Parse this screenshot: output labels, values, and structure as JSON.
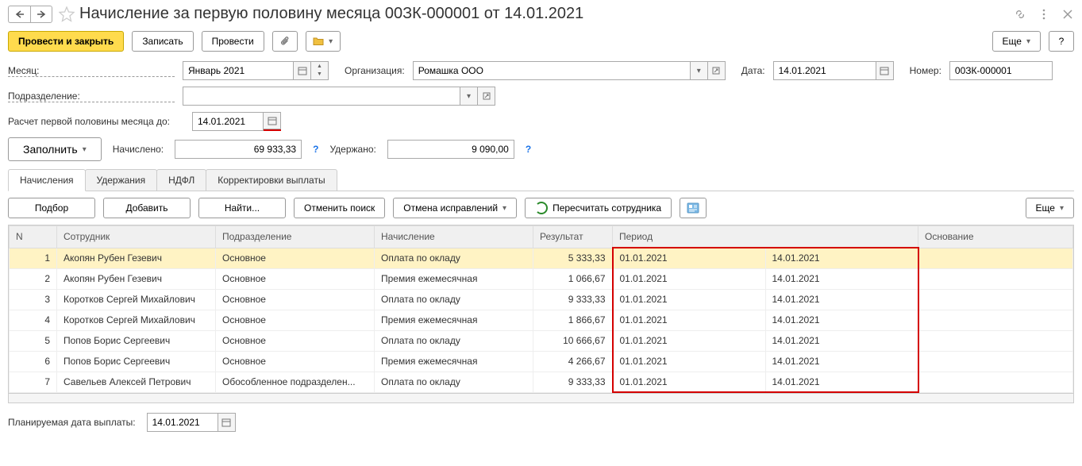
{
  "header": {
    "title": "Начисление за первую половину месяца 00ЗК-000001 от 14.01.2021"
  },
  "toolbar": {
    "post_close": "Провести и закрыть",
    "save": "Записать",
    "post": "Провести",
    "more": "Еще"
  },
  "form": {
    "month_label": "Месяц:",
    "month_value": "Январь 2021",
    "org_label": "Организация:",
    "org_value": "Ромашка ООО",
    "date_label": "Дата:",
    "date_value": "14.01.2021",
    "number_label": "Номер:",
    "number_value": "00ЗК-000001",
    "dept_label": "Подразделение:",
    "dept_value": "",
    "half_until_label": "Расчет первой половины месяца до:",
    "half_until_value": "14.01.2021",
    "fill_btn": "Заполнить",
    "accrued_label": "Начислено:",
    "accrued_value": "69 933,33",
    "withheld_label": "Удержано:",
    "withheld_value": "9 090,00"
  },
  "tabs": {
    "t1": "Начисления",
    "t2": "Удержания",
    "t3": "НДФЛ",
    "t4": "Корректировки выплаты"
  },
  "tab_toolbar": {
    "select": "Подбор",
    "add": "Добавить",
    "find": "Найти...",
    "cancel_find": "Отменить поиск",
    "cancel_fix": "Отмена исправлений",
    "recalc": "Пересчитать сотрудника",
    "more": "Еще"
  },
  "columns": {
    "n": "N",
    "emp": "Сотрудник",
    "dep": "Подразделение",
    "calc": "Начисление",
    "res": "Результат",
    "per": "Период",
    "base": "Основание"
  },
  "rows": [
    {
      "n": "1",
      "emp": "Акопян Рубен Гезевич",
      "dep": "Основное",
      "calc": "Оплата по окладу",
      "res": "5 333,33",
      "p1": "01.01.2021",
      "p2": "14.01.2021"
    },
    {
      "n": "2",
      "emp": "Акопян Рубен Гезевич",
      "dep": "Основное",
      "calc": "Премия ежемесячная",
      "res": "1 066,67",
      "p1": "01.01.2021",
      "p2": "14.01.2021"
    },
    {
      "n": "3",
      "emp": "Коротков Сергей Михайлович",
      "dep": "Основное",
      "calc": "Оплата по окладу",
      "res": "9 333,33",
      "p1": "01.01.2021",
      "p2": "14.01.2021"
    },
    {
      "n": "4",
      "emp": "Коротков Сергей Михайлович",
      "dep": "Основное",
      "calc": "Премия ежемесячная",
      "res": "1 866,67",
      "p1": "01.01.2021",
      "p2": "14.01.2021"
    },
    {
      "n": "5",
      "emp": "Попов Борис Сергеевич",
      "dep": "Основное",
      "calc": "Оплата по окладу",
      "res": "10 666,67",
      "p1": "01.01.2021",
      "p2": "14.01.2021"
    },
    {
      "n": "6",
      "emp": "Попов Борис Сергеевич",
      "dep": "Основное",
      "calc": "Премия ежемесячная",
      "res": "4 266,67",
      "p1": "01.01.2021",
      "p2": "14.01.2021"
    },
    {
      "n": "7",
      "emp": "Савельев Алексей Петрович",
      "dep": "Обособленное подразделен...",
      "calc": "Оплата по окладу",
      "res": "9 333,33",
      "p1": "01.01.2021",
      "p2": "14.01.2021"
    }
  ],
  "footer": {
    "planned_label": "Планируемая дата выплаты:",
    "planned_value": "14.01.2021"
  }
}
